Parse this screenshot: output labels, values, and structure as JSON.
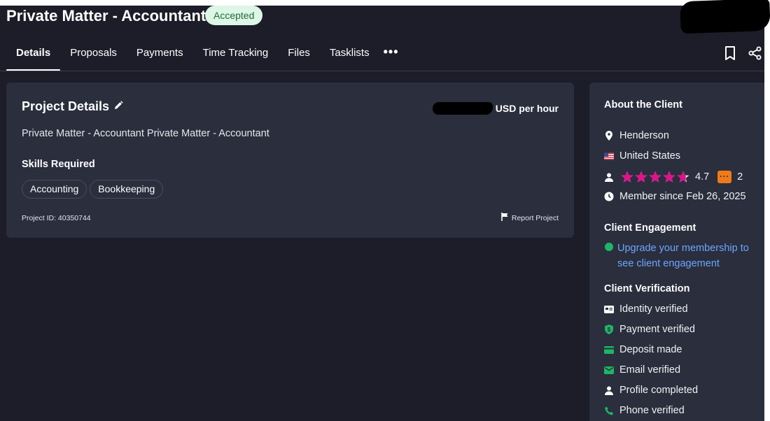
{
  "header": {
    "title": "Private Matter - Accountant",
    "status_badge": "Accepted"
  },
  "tabs": [
    {
      "label": "Details",
      "active": true
    },
    {
      "label": "Proposals",
      "active": false
    },
    {
      "label": "Payments",
      "active": false
    },
    {
      "label": "Time Tracking",
      "active": false
    },
    {
      "label": "Files",
      "active": false
    },
    {
      "label": "Tasklists",
      "active": false
    }
  ],
  "tabs_more_label": "•••",
  "project": {
    "heading": "Project Details",
    "rate_suffix": "USD per hour",
    "description": "Private Matter - Accountant Private Matter - Accountant",
    "skills_heading": "Skills Required",
    "skills": [
      "Accounting",
      "Bookkeeping"
    ],
    "project_id": "Project ID: 40350744",
    "report_label": "Report Project"
  },
  "client": {
    "about_heading": "About the Client",
    "city": "Henderson",
    "country": "United States",
    "rating": "4.7",
    "rating_stars": 4.7,
    "reviews": "2",
    "member_since": "Member since Feb 26, 2025",
    "engagement_heading": "Client Engagement",
    "engagement_link_1": "Upgrade your membership to",
    "engagement_link_2": "see client engagement",
    "verification_heading": "Client Verification",
    "verifications": [
      {
        "label": "Identity verified",
        "icon": "id-card-icon"
      },
      {
        "label": "Payment verified",
        "icon": "shield-icon"
      },
      {
        "label": "Deposit made",
        "icon": "credit-card-icon"
      },
      {
        "label": "Email verified",
        "icon": "mail-icon"
      },
      {
        "label": "Profile completed",
        "icon": "person-icon"
      },
      {
        "label": "Phone verified",
        "icon": "phone-icon"
      }
    ]
  },
  "colors": {
    "background": "#1c1d28",
    "panel": "#2a2e3d",
    "star": "#e0128a",
    "verified": "#1eb564",
    "link": "#6ea6ff",
    "badge_bg": "#ddf6e6"
  }
}
